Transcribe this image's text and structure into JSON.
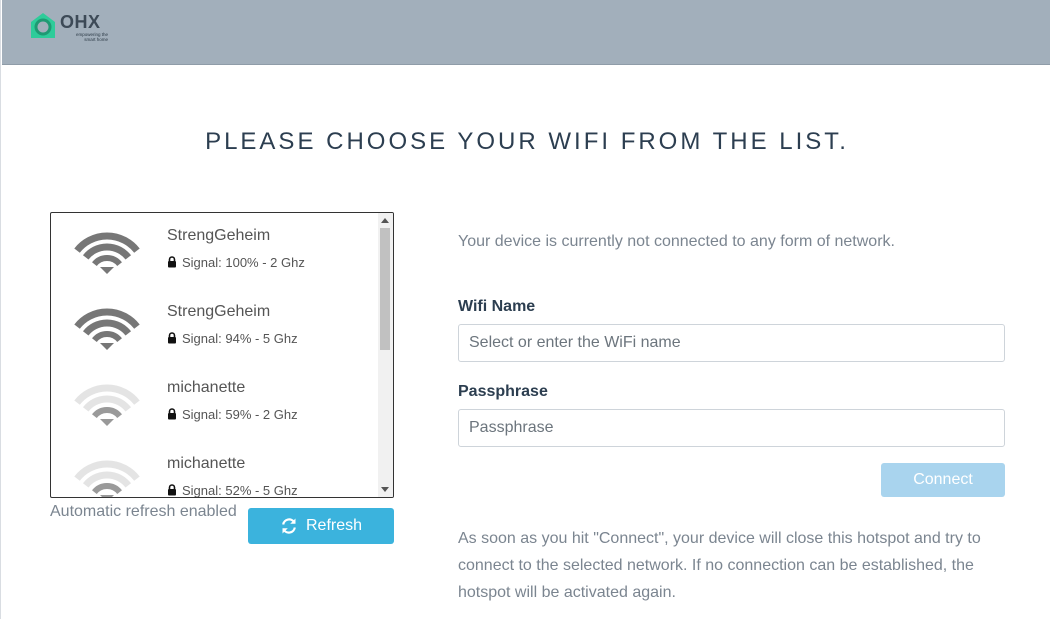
{
  "header": {
    "logo_text": "OHX",
    "logo_tagline": "empowering the smart home"
  },
  "title": "PLEASE CHOOSE YOUR WIFI FROM THE LIST.",
  "networks": [
    {
      "name": "StrengGeheim",
      "info": "Signal: 100% - 2 Ghz",
      "strength": 1.0
    },
    {
      "name": "StrengGeheim",
      "info": "Signal: 94% - 5 Ghz",
      "strength": 0.94
    },
    {
      "name": "michanette",
      "info": "Signal: 59% - 2 Ghz",
      "strength": 0.59
    },
    {
      "name": "michanette",
      "info": "Signal: 52% - 5 Ghz",
      "strength": 0.52
    }
  ],
  "auto_refresh_text": "Automatic refresh enabled",
  "refresh_label": "Refresh",
  "status_text": "Your device is currently not connected to any form of network.",
  "wifi_field": {
    "label": "Wifi Name",
    "placeholder": "Select or enter the WiFi name"
  },
  "pass_field": {
    "label": "Passphrase",
    "placeholder": "Passphrase"
  },
  "connect_label": "Connect",
  "info_text": "As soon as you hit \"Connect\", your device will close this hotspot and try to connect to the selected network. If no connection can be established, the hotspot will be activated again.",
  "colors": {
    "header_bg": "#a2afbb",
    "strong_signal": "#777777",
    "weak_signal": "#e6e6e6",
    "refresh_btn": "#3bb3dd",
    "connect_btn_disabled": "#a9d4ee"
  }
}
